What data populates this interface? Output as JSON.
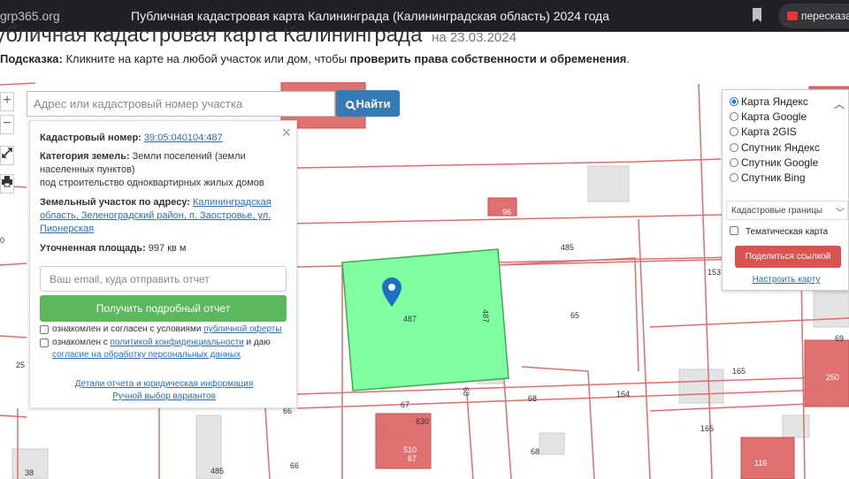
{
  "browser": {
    "url": "grp365.org",
    "tab_title": "Публичная кадастровая карта Калининграда (Калининградская область) 2024 года",
    "extension_label": "пересказать"
  },
  "page": {
    "heading": "убличная кадастровая карта Калининграда",
    "heading_date": "на 23.03.2024",
    "hint_prefix": "Подсказка:",
    "hint_text": "Кликните на карте на любой участок или дом, чтобы",
    "hint_bold": "проверить права собственности и обременения",
    "hint_end": "."
  },
  "search": {
    "placeholder": "Адрес или кадастровый номер участка",
    "button_label": "Найти"
  },
  "zoom": {
    "plus": "+",
    "minus": "−"
  },
  "info": {
    "cad_label": "Кадастровый номер:",
    "cad_value": "39:05:040104:487",
    "cat_label": "Категория земель:",
    "cat_value": "Земли поселений (земли населенных пунктов)",
    "cat_use": "под строительство одноквартирных жилых домов",
    "addr_label": "Земельный участок по адресу:",
    "addr_value": "Калининградская область, Зеленоградский район, п. Заостровье, ул. Пионерская",
    "area_label": "Уточненная площадь:",
    "area_value": "997 кв м",
    "email_placeholder": "Ваш email, куда отправить отчет",
    "report_button": "Получить подробный отчет",
    "cb1_text": "ознакомлен и согласен с условиями",
    "cb1_link": "публичной оферты",
    "cb2_text": "ознакомлен с",
    "cb2_link1": "политикой конфиденциальности",
    "cb2_mid": "и даю",
    "cb2_link2": "согласие на обработку персональных данных",
    "link_details": "Детали отчета и юридическая информация",
    "link_manual": "Ручной выбор вариантов"
  },
  "layers": {
    "options": [
      {
        "label": "Карта Яндекс",
        "selected": true
      },
      {
        "label": "Карта Google",
        "selected": false
      },
      {
        "label": "Карта 2GIS",
        "selected": false
      },
      {
        "label": "Спутник Яндекс",
        "selected": false
      },
      {
        "label": "Спутник Google",
        "selected": false
      },
      {
        "label": "Спутник Bing",
        "selected": false
      }
    ],
    "select_value": "Кадастровые границы",
    "thematic_label": "Тематическая карта",
    "share_button": "Поделиться ссылкой",
    "configure_link": "Настроить карту"
  },
  "map_labels": {
    "parcel": "487",
    "l96": "96",
    "l485a": "485",
    "l65": "65",
    "l153": "153",
    "l165a": "165",
    "l250": "250",
    "l164": "164",
    "l165b": "165",
    "l116": "116",
    "l67a": "67",
    "l68a": "68",
    "l68b": "68",
    "l68c": "68",
    "l66a": "66",
    "l66b": "66",
    "l485b": "485",
    "l38": "38",
    "l25": "25",
    "l0": "0",
    "l510": "510",
    "l67b": "67",
    "l630": "630",
    "l69": "69"
  },
  "colors": {
    "parcel_fill": "#7fff9f",
    "building_red": "#e06a6a",
    "boundary": "#d97070",
    "accent_blue": "#337ab7",
    "green_button": "#5cb85c",
    "red_button": "#d9534f"
  }
}
